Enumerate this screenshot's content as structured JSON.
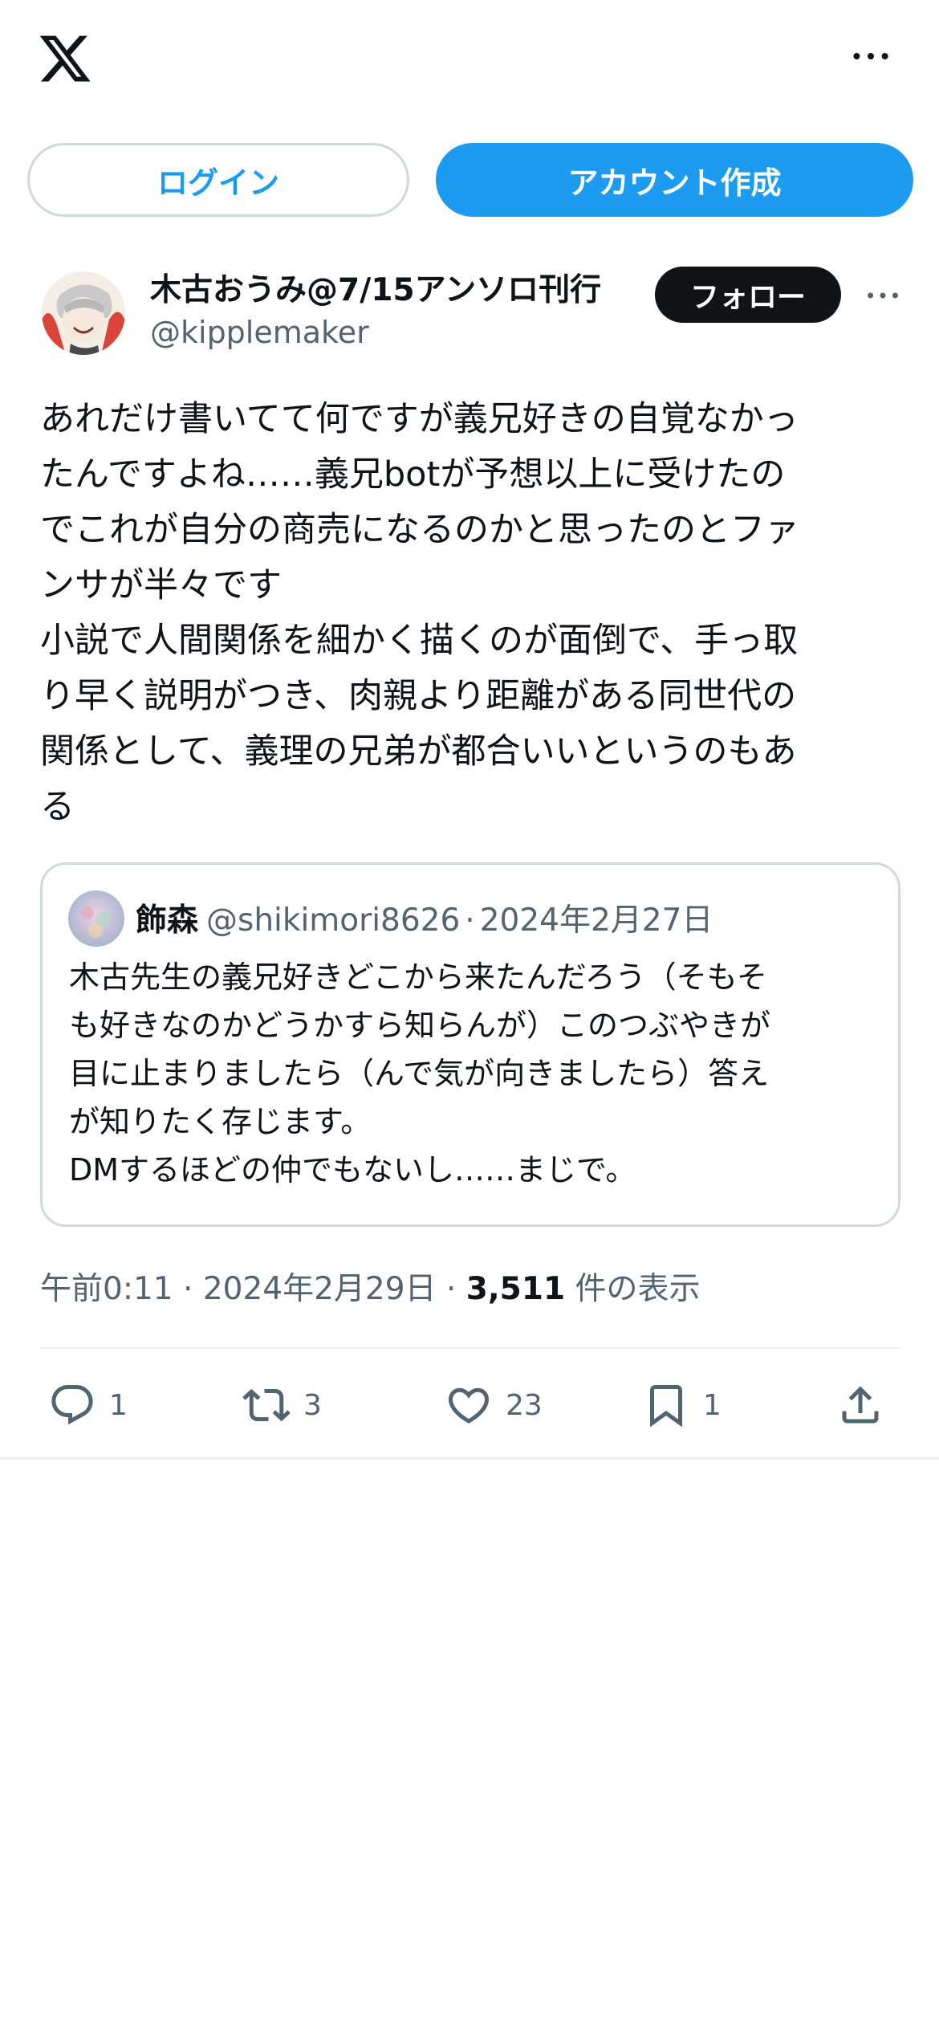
{
  "header": {
    "logo_icon": "x-logo-icon",
    "more_icon": "more-horizontal-icon"
  },
  "auth": {
    "login_label": "ログイン",
    "signup_label": "アカウント作成"
  },
  "tweet": {
    "author_name": "木古おうみ@7/15アンソロ刊行",
    "author_handle": "@kipplemaker",
    "follow_label": "フォロー",
    "text": "あれだけ書いてて何ですが義兄好きの自覚なかっ\nたんですよね……義兄botが予想以上に受けたの\nでこれが自分の商売になるのかと思ったのとファ\nンサが半々です\n小説で人間関係を細かく描くのが面倒で、手っ取\nり早く説明がつき、肉親より距離がある同世代の\n関係として、義理の兄弟が都合いいというのもあ\nる",
    "time": "午前0:11",
    "date": "2024年2月29日",
    "separator": "·",
    "views_count": "3,511",
    "views_label": "件の表示"
  },
  "quote": {
    "name": "飾森",
    "handle": "@shikimori8626",
    "separator": "·",
    "date": "2024年2月27日",
    "text": "木古先生の義兄好きどこから来たんだろう（そもそ\nも好きなのかどうかすら知らんが）このつぶやきが\n目に止まりましたら（んで気が向きましたら）答え\nが知りたく存じます。\nDMするほどの仲でもないし……まじで。"
  },
  "actions": {
    "reply_count": "1",
    "retweet_count": "3",
    "like_count": "23",
    "bookmark_count": "1"
  },
  "colors": {
    "accent": "#1d9bf0",
    "text_primary": "#0f1419",
    "text_secondary": "#536471",
    "border": "#cfd9de"
  }
}
